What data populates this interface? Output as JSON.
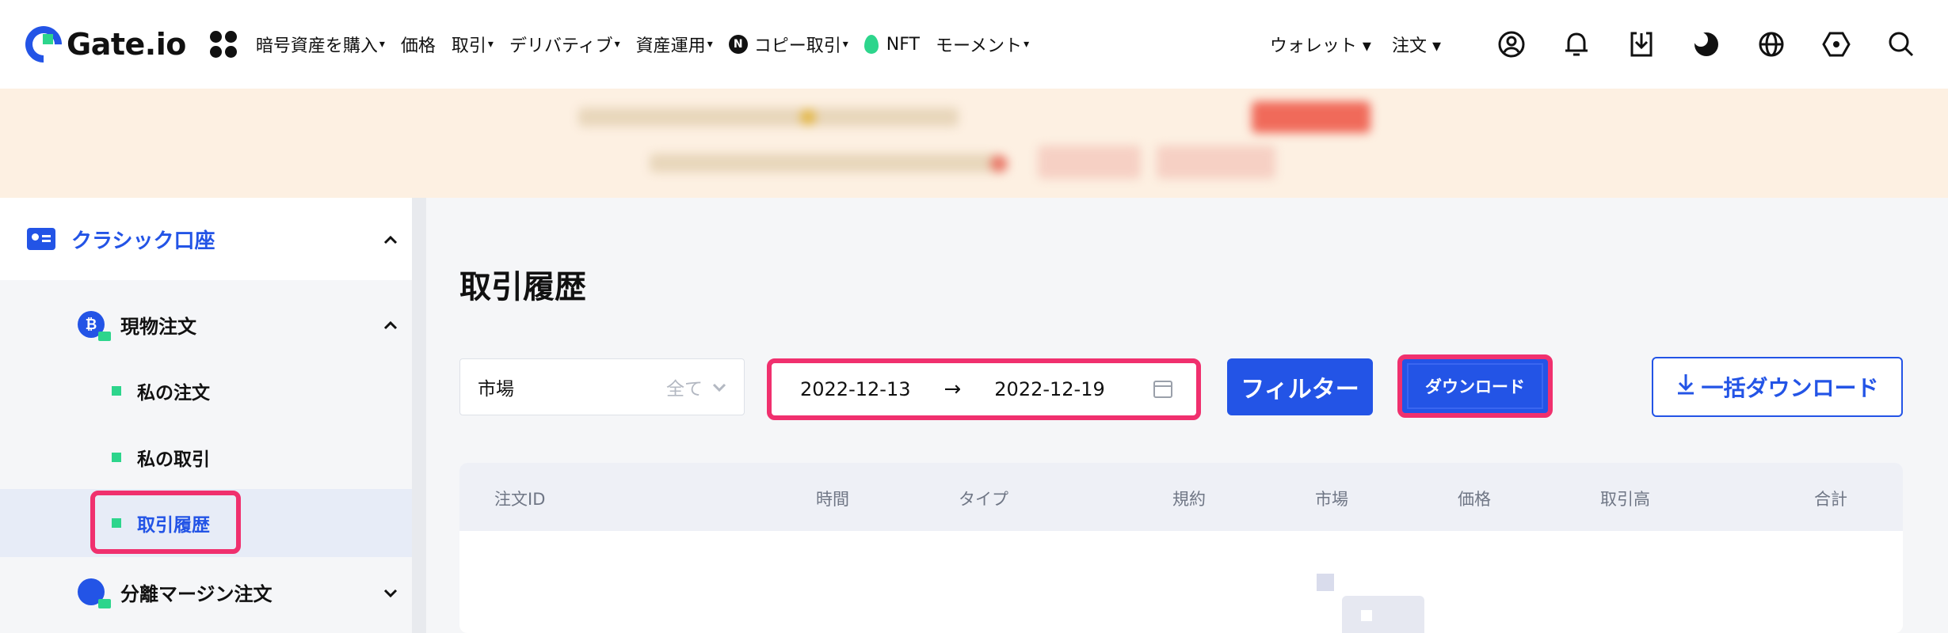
{
  "header": {
    "logo_text": "Gate.io",
    "nav": [
      {
        "label": "暗号資産を購入",
        "caret": "▾"
      },
      {
        "label": "価格",
        "caret": ""
      },
      {
        "label": "取引",
        "caret": "▾"
      },
      {
        "label": "デリバティブ",
        "caret": "▾"
      },
      {
        "label": "資産運用",
        "caret": "▾"
      },
      {
        "label": "コピー取引",
        "caret": "▾",
        "badge": "N"
      },
      {
        "label": "NFT",
        "caret": ""
      },
      {
        "label": "モーメント",
        "caret": "▾"
      }
    ],
    "right": {
      "wallet": "ウォレット ▾",
      "orders": "注文 ▾"
    },
    "icons": [
      "user-icon",
      "bell-icon",
      "download-app-icon",
      "theme-icon",
      "globe-icon",
      "settings-icon",
      "search-icon"
    ]
  },
  "sidebar": {
    "section_label": "クラシック口座",
    "spot": {
      "label": "現物注文",
      "icon_char": "₿"
    },
    "items": [
      "私の注文",
      "私の取引",
      "取引履歴"
    ],
    "margin": {
      "label": "分離マージン注文"
    }
  },
  "main": {
    "title": "取引履歴",
    "market_label": "市場",
    "market_value": "全て",
    "date_from": "2022-12-13",
    "date_arrow": "→",
    "date_to": "2022-12-19",
    "filter_button": "フィルター",
    "download_button": "ダウンロード",
    "bulk_download_button": "一括ダウンロード",
    "columns": [
      "注文ID",
      "時間",
      "タイプ",
      "規約",
      "市場",
      "価格",
      "取引高",
      "合計"
    ]
  },
  "colors": {
    "accent": "#2354e6",
    "highlight": "#f0306e",
    "green": "#2dd58c",
    "banner": "#fdf0e2"
  }
}
